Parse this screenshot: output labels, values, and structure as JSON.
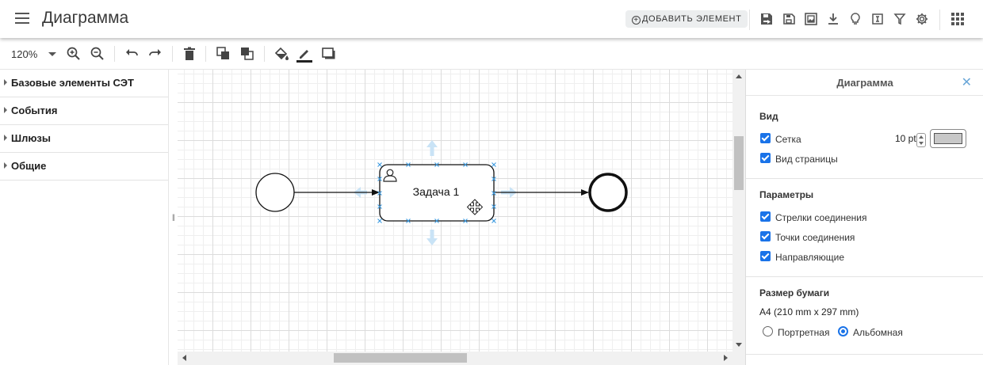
{
  "header": {
    "title": "Диаграмма",
    "add_element_label": "ДОБАВИТЬ ЭЛЕМЕНТ",
    "icons": [
      "save-as-icon",
      "save-icon",
      "export-image-icon",
      "download-icon",
      "lightbulb-icon",
      "text-icon",
      "filter-icon",
      "gear-icon",
      "apps-grid-icon"
    ]
  },
  "toolbar": {
    "zoom": "120%",
    "icons": [
      "zoom-in-icon",
      "zoom-out-icon",
      "undo-icon",
      "redo-icon",
      "delete-icon",
      "to-front-icon",
      "to-back-icon",
      "fill-color-icon",
      "line-color-icon",
      "shadow-icon"
    ]
  },
  "sidebar": {
    "categories": [
      {
        "label": "Базовые элементы СЭТ"
      },
      {
        "label": "События"
      },
      {
        "label": "Шлюзы"
      },
      {
        "label": "Общие"
      }
    ]
  },
  "diagram": {
    "task_label": "Задача 1",
    "selection_color": "#3d9be0",
    "hover_arrow_color": "#c9e3f6"
  },
  "format_panel": {
    "title": "Диаграмма",
    "view": {
      "title": "Вид",
      "grid_label": "Сетка",
      "grid_checked": true,
      "grid_size": "10 pt",
      "grid_color": "#c8c8c8",
      "page_view_label": "Вид страницы",
      "page_view_checked": true
    },
    "params": {
      "title": "Параметры",
      "connection_arrows": "Стрелки соединения",
      "connection_points": "Точки соединения",
      "guides": "Направляющие"
    },
    "paper": {
      "title": "Размер бумаги",
      "size": "A4 (210 mm x 297 mm)",
      "portrait_label": "Портретная",
      "landscape_label": "Альбомная",
      "selected": "landscape"
    }
  },
  "colors": {
    "accent": "#1a73e8",
    "close_icon": "#6aa7d8"
  }
}
